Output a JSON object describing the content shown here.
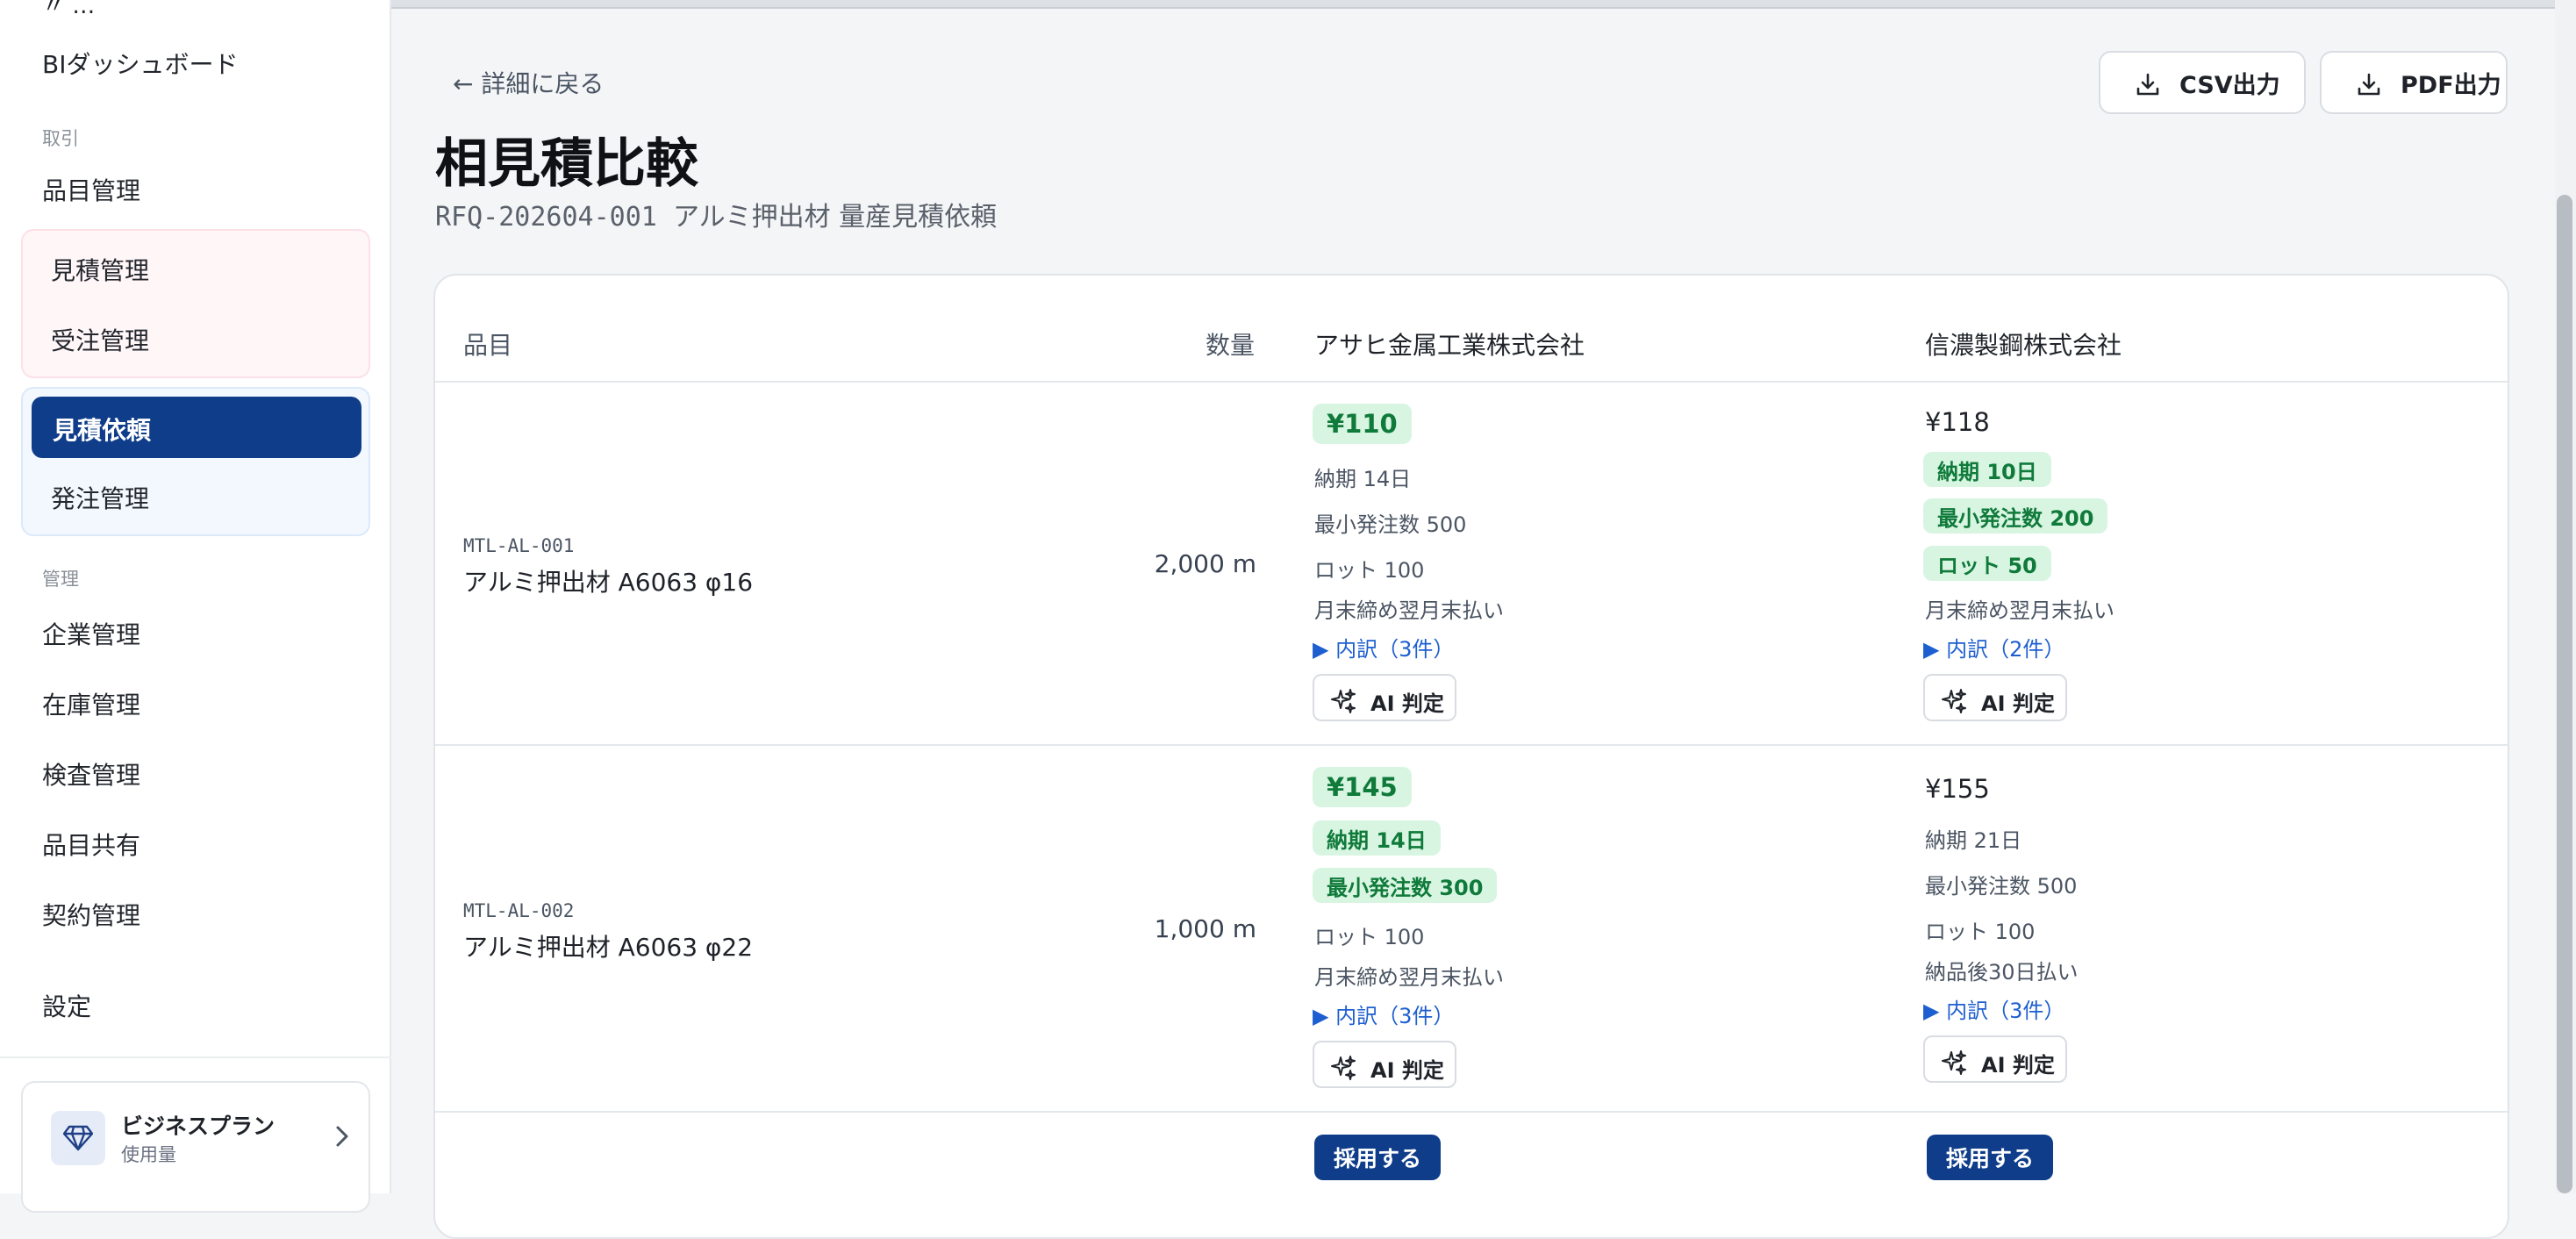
{
  "sidebar": {
    "top_partial": "〃 …",
    "bi": "BIダッシュボード",
    "section_trade": "取引",
    "item_master": "品目管理",
    "quote_mgmt": "見積管理",
    "order_mgmt": "受注管理",
    "rfq": "見積依頼",
    "po_mgmt": "発注管理",
    "section_admin": "管理",
    "company": "企業管理",
    "inventory": "在庫管理",
    "inspection": "検査管理",
    "item_share": "品目共有",
    "contract": "契約管理",
    "settings": "設定",
    "plan": {
      "title": "ビジネスプラン",
      "subtitle": "使用量"
    }
  },
  "header": {
    "back": "← 詳細に戻る",
    "title": "相見積比較",
    "rfq_no": "RFQ-202604-001",
    "rfq_name": "アルミ押出材 量産見積依頼",
    "csv": "CSV出力",
    "pdf": "PDF出力"
  },
  "table": {
    "col_item": "品目",
    "col_qty": "数量",
    "suppliers": [
      "アサヒ金属工業株式会社",
      "信濃製鋼株式会社"
    ],
    "rows": [
      {
        "code": "MTL-AL-001",
        "name": "アルミ押出材 A6063 φ16",
        "qty": "2,000 m",
        "quotes": [
          {
            "price": "¥110",
            "lead": "納期 14日",
            "moq": "最小発注数 500",
            "lot": "ロット 100",
            "terms": "月末締め翌月末払い",
            "detail": "▶ 内訳（3件）",
            "ai": "AI 判定"
          },
          {
            "price": "¥118",
            "lead": "納期 10日",
            "moq": "最小発注数 200",
            "lot": "ロット 50",
            "terms": "月末締め翌月末払い",
            "detail": "▶ 内訳（2件）",
            "ai": "AI 判定"
          }
        ]
      },
      {
        "code": "MTL-AL-002",
        "name": "アルミ押出材 A6063 φ22",
        "qty": "1,000 m",
        "quotes": [
          {
            "price": "¥145",
            "lead": "納期 14日",
            "moq": "最小発注数 300",
            "lot": "ロット 100",
            "terms": "月末締め翌月末払い",
            "detail": "▶ 内訳（3件）",
            "ai": "AI 判定"
          },
          {
            "price": "¥155",
            "lead": "納期 21日",
            "moq": "最小発注数 500",
            "lot": "ロット 100",
            "terms": "納品後30日払い",
            "detail": "▶ 内訳（3件）",
            "ai": "AI 判定"
          }
        ]
      }
    ],
    "adopt": "採用する"
  },
  "colors": {
    "primary": "#0f3d8a",
    "best_bg": "#d8f5e2",
    "best_fg": "#0f7a3a",
    "link": "#1d5fd0"
  }
}
